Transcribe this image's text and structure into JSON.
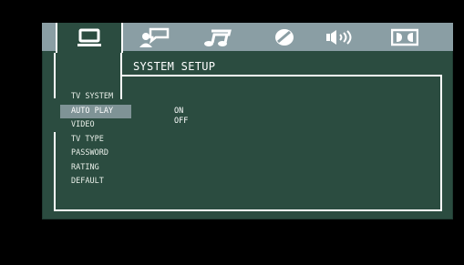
{
  "tabs": [
    {
      "icon": "general-setup-icon",
      "active": true
    },
    {
      "icon": "language-setup-icon",
      "active": false
    },
    {
      "icon": "audio-setup-icon",
      "active": false
    },
    {
      "icon": "video-setup-icon",
      "active": false
    },
    {
      "icon": "speaker-setup-icon",
      "active": false
    },
    {
      "icon": "dolby-digital-icon",
      "active": false
    }
  ],
  "title": "SYSTEM SETUP",
  "menu": {
    "items": [
      {
        "label": "TV SYSTEM"
      },
      {
        "label": "AUTO PLAY",
        "selected": true
      },
      {
        "label": "VIDEO"
      },
      {
        "label": "TV TYPE"
      },
      {
        "label": "PASSWORD"
      },
      {
        "label": "RATING"
      },
      {
        "label": "DEFAULT"
      }
    ]
  },
  "options": [
    "ON",
    "OFF"
  ],
  "colors": {
    "panel": "#2b4c40",
    "icon_bar": "#8a9ea4",
    "highlight": "#7f9396",
    "text": "#ffffff"
  }
}
